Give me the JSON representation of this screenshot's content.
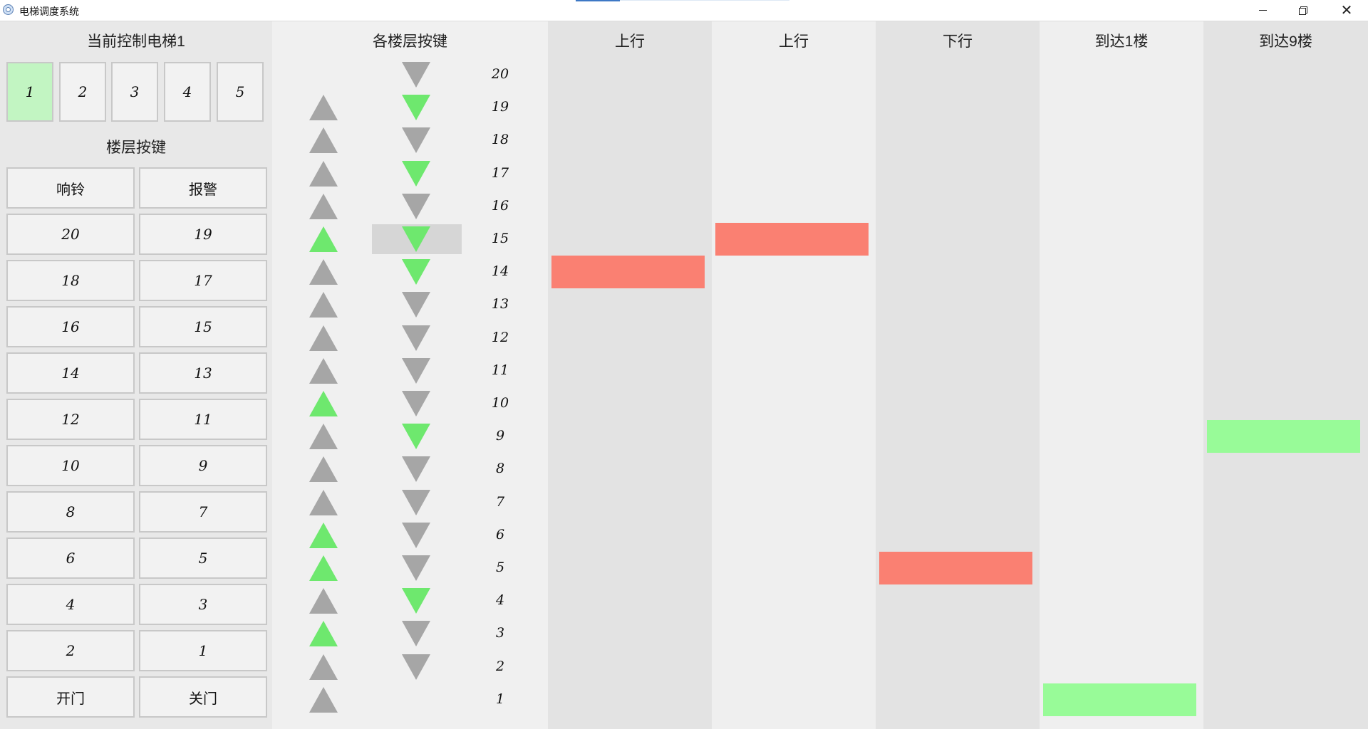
{
  "window": {
    "title": "电梯调度系统",
    "controls": {
      "minimize": "—",
      "close": "✕"
    }
  },
  "left_panel": {
    "current_label": "当前控制电梯1",
    "elevator_buttons": [
      "1",
      "2",
      "3",
      "4",
      "5"
    ],
    "selected_elevator": "1",
    "selected_color": "#c2f5c2",
    "floor_label": "楼层按键",
    "buttons": [
      [
        "响铃",
        "报警"
      ],
      [
        "20",
        "19"
      ],
      [
        "18",
        "17"
      ],
      [
        "16",
        "15"
      ],
      [
        "14",
        "13"
      ],
      [
        "12",
        "11"
      ],
      [
        "10",
        "9"
      ],
      [
        "8",
        "7"
      ],
      [
        "6",
        "5"
      ],
      [
        "4",
        "3"
      ],
      [
        "2",
        "1"
      ],
      [
        "开门",
        "关门"
      ]
    ]
  },
  "call_panel": {
    "title": "各楼层按键",
    "highlighted_floor": 15,
    "floors": [
      {
        "floor": "20",
        "up": null,
        "down": false
      },
      {
        "floor": "19",
        "up": false,
        "down": true
      },
      {
        "floor": "18",
        "up": false,
        "down": false
      },
      {
        "floor": "17",
        "up": false,
        "down": true
      },
      {
        "floor": "16",
        "up": false,
        "down": false
      },
      {
        "floor": "15",
        "up": true,
        "down": true
      },
      {
        "floor": "14",
        "up": false,
        "down": true
      },
      {
        "floor": "13",
        "up": false,
        "down": false
      },
      {
        "floor": "12",
        "up": false,
        "down": false
      },
      {
        "floor": "11",
        "up": false,
        "down": false
      },
      {
        "floor": "10",
        "up": true,
        "down": false
      },
      {
        "floor": "9",
        "up": false,
        "down": true
      },
      {
        "floor": "8",
        "up": false,
        "down": false
      },
      {
        "floor": "7",
        "up": false,
        "down": false
      },
      {
        "floor": "6",
        "up": true,
        "down": false
      },
      {
        "floor": "5",
        "up": true,
        "down": false
      },
      {
        "floor": "4",
        "up": false,
        "down": true
      },
      {
        "floor": "3",
        "up": true,
        "down": false
      },
      {
        "floor": "2",
        "up": false,
        "down": false
      },
      {
        "floor": "1",
        "up": false,
        "down": null
      }
    ],
    "colors": {
      "lit": "#6ee86e",
      "idle": "#a6a6a6"
    }
  },
  "shafts": [
    {
      "status": "上行",
      "floor": 14,
      "color": "#fa8072"
    },
    {
      "status": "上行",
      "floor": 15,
      "color": "#fa8072"
    },
    {
      "status": "下行",
      "floor": 5,
      "color": "#fa8072"
    },
    {
      "status": "到达1楼",
      "floor": 1,
      "color": "#98fb98"
    },
    {
      "status": "到达9楼",
      "floor": 9,
      "color": "#98fb98"
    }
  ],
  "shaft_backgrounds": [
    "#e3e3e3",
    "#efefef",
    "#e3e3e3",
    "#efefef",
    "#e3e3e3"
  ]
}
